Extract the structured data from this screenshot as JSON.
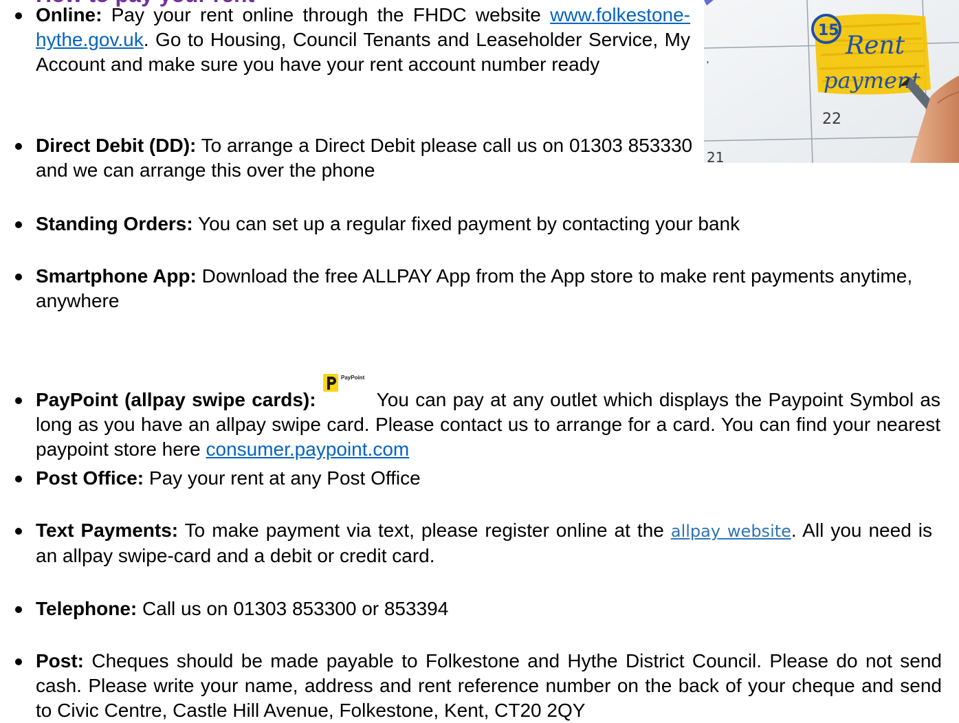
{
  "heading_fragment": "How to pay your rent",
  "items": [
    {
      "label": "Online:",
      "text_before": " Pay your rent online through the FHDC website ",
      "link": "www.folkestone-hythe.gov.uk",
      "text_after": ". Go to Housing, Council Tenants and Leaseholder Service, My Account and make sure you have your rent account number ready"
    },
    {
      "label": "Direct Debit (DD):",
      "text": " To arrange a Direct Debit please call us on 01303 853330 and we can arrange this over the phone"
    },
    {
      "label": "Standing Orders:",
      "text": "  You can set up a regular fixed payment by contacting your bank"
    },
    {
      "label": "Smartphone App:",
      "text": "  Download the free ALLPAY App from the App store to make rent payments anytime, anywhere"
    },
    {
      "label": "PayPoint (allpay swipe cards):",
      "logo_text": "PayPoint",
      "text": " You can pay at any outlet which displays the Paypoint Symbol as long as you have an allpay swipe card.  Please contact us to arrange for a card. You can find your nearest paypoint store here ",
      "link": "consumer.paypoint.com"
    },
    {
      "label": "Post Office:",
      "text": "  Pay your rent at any Post Office"
    },
    {
      "label": "Text Payments:",
      "text_before": "  To make payment via text, please register online at the ",
      "link": "allpay website",
      "text_after": ".  All you need is an allpay swipe-card and a debit or credit card."
    },
    {
      "label": "Telephone:",
      "text": "  Call us on 01303 853300 or 853394"
    },
    {
      "label": "Post:",
      "text": "  Cheques should be made payable to Folkestone and Hythe District Council.  Please do not send cash.  Please write your name, address and rent reference number on the back of your cheque and send to Civic Centre, Castle Hill Avenue, Folkestone, Kent, CT20 2QY"
    }
  ],
  "calendar_image": {
    "circle_number": "15",
    "note_line1": "Rent",
    "note_line2": "payment",
    "day_lower": "22",
    "day_left": "21",
    "highlight_color": "#f5c400",
    "ink_color": "#1b4fa8"
  },
  "colors": {
    "heading": "#7030a0",
    "link": "#0563c1",
    "paypoint_yellow": "#f9d616"
  }
}
